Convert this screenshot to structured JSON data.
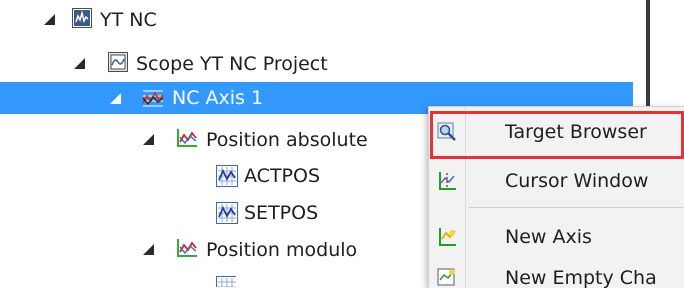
{
  "tree": {
    "root": {
      "label": "YT NC",
      "icon": "scope-project-icon"
    },
    "project": {
      "label": "Scope YT NC Project",
      "icon": "scope-chart-icon"
    },
    "axis": {
      "label": "NC Axis 1",
      "icon": "axis-chart-icon",
      "selected": true
    },
    "channel1": {
      "label": "Position absolute",
      "icon": "channel-icon"
    },
    "acpos": {
      "label": "ACTPOS",
      "icon": "acquisition-icon"
    },
    "setpos": {
      "label": "SETPOS",
      "icon": "acquisition-icon"
    },
    "channel2": {
      "label": "Position modulo",
      "icon": "channel-icon"
    }
  },
  "context_menu": {
    "items": [
      {
        "label": "Target Browser",
        "icon": "target-browser-icon"
      },
      {
        "label": "Cursor Window",
        "icon": "cursor-window-icon"
      },
      {
        "label": "New Axis",
        "icon": "new-axis-icon"
      },
      {
        "label": "New Empty Cha",
        "icon": "new-chart-icon"
      }
    ]
  },
  "colors": {
    "selection": "#3399ff",
    "highlight_box": "#e5323a"
  }
}
